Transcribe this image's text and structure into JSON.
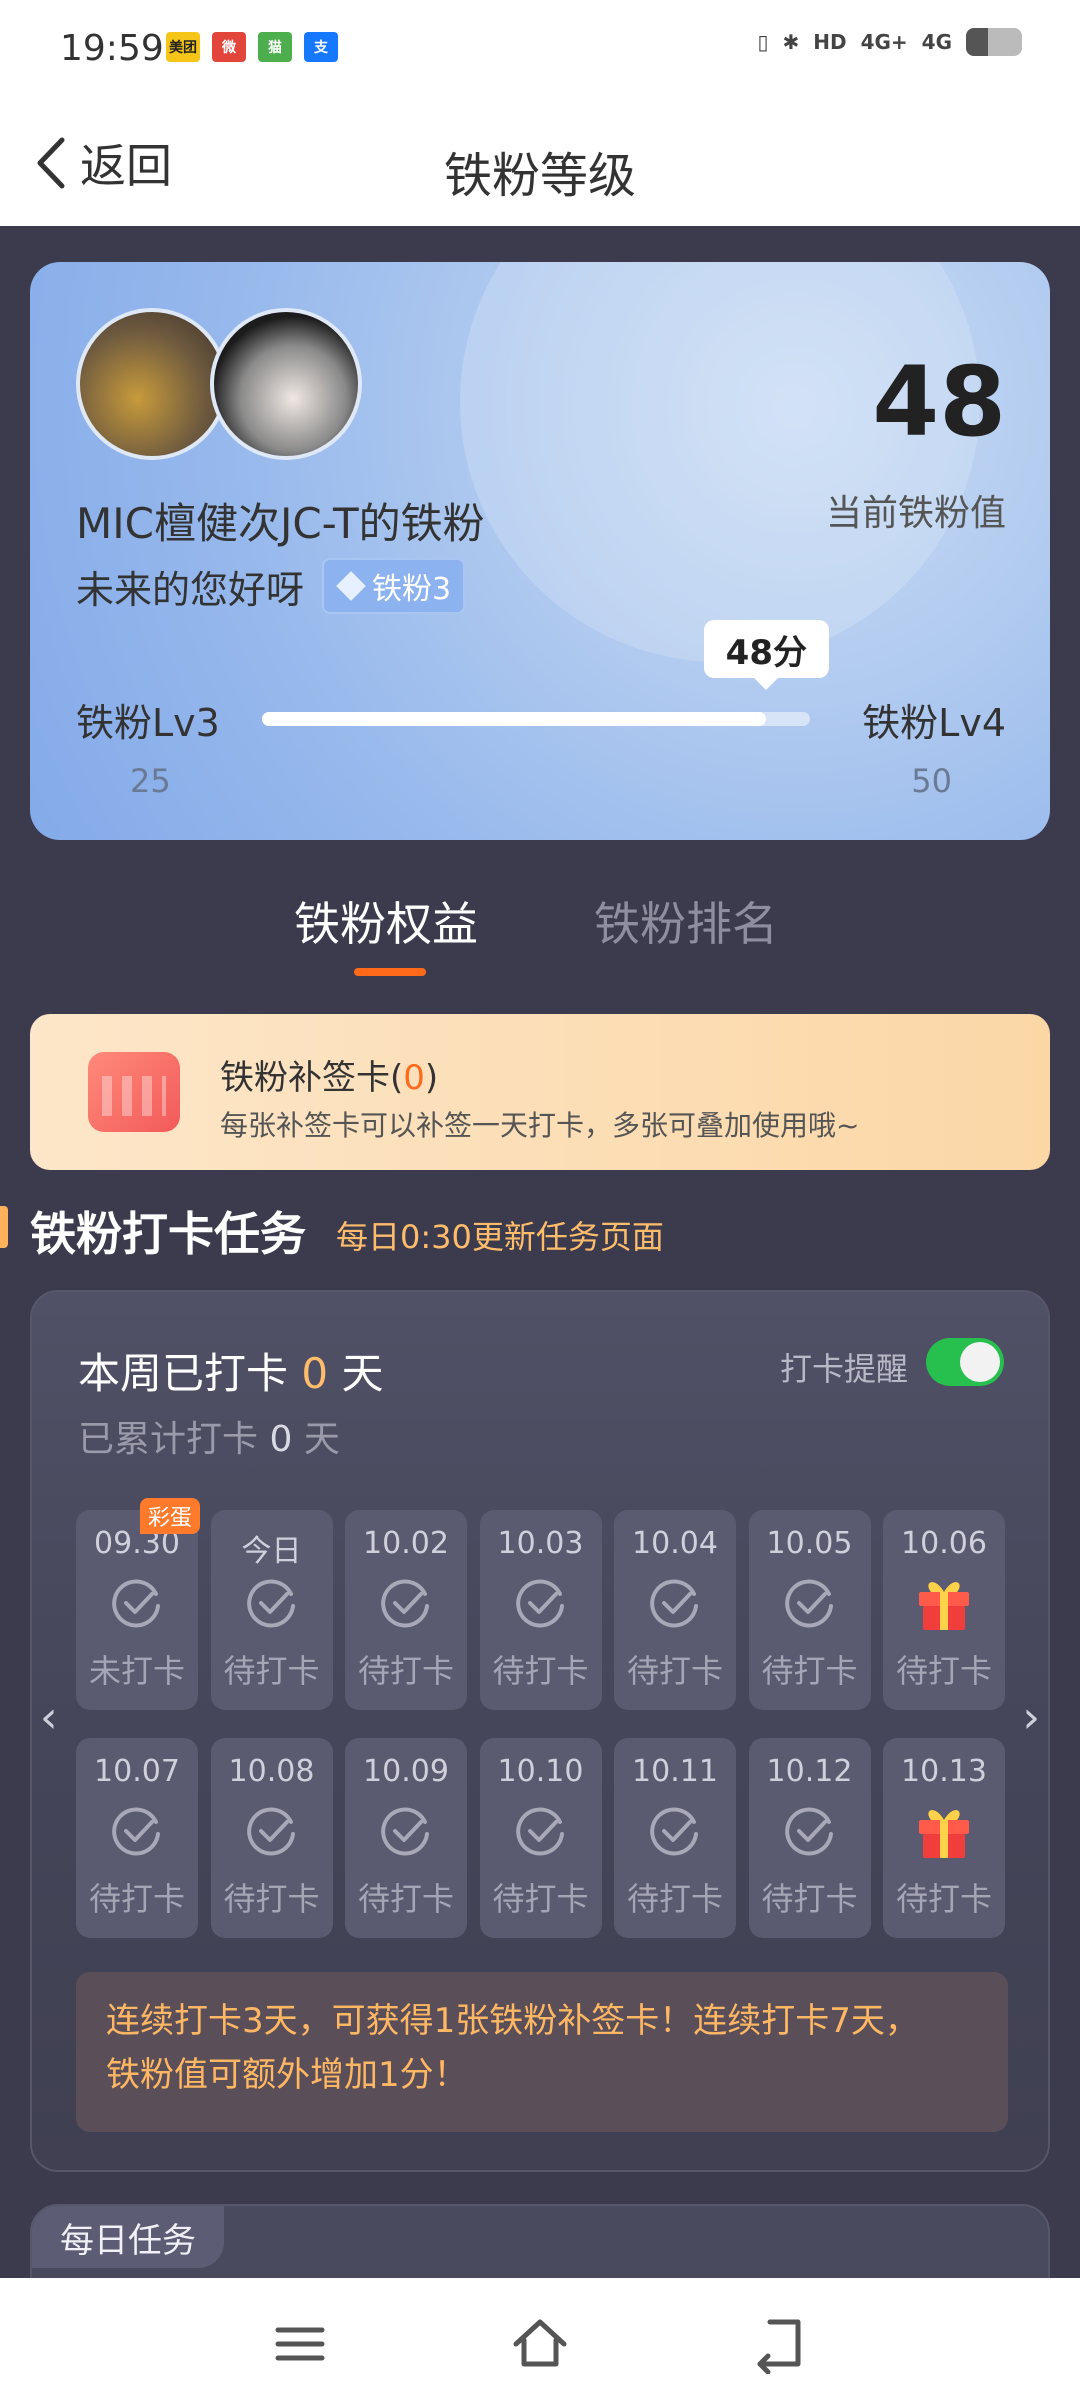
{
  "status_bar": {
    "time": "19:59",
    "apps": [
      {
        "label": "美团",
        "color": "#f5c518"
      },
      {
        "label": "微",
        "color": "#e2463b"
      },
      {
        "label": "猫",
        "color": "#4cae4c"
      },
      {
        "label": "支",
        "color": "#1677ff"
      }
    ],
    "network": "4G+",
    "network2": "4G",
    "battery_level": 0.4
  },
  "nav": {
    "back_label": "返回",
    "title": "铁粉等级"
  },
  "fan_card": {
    "fan_name": "MIC檀健次JC-T的铁粉",
    "greeting": "未来的您好呀",
    "badge": "铁粉3",
    "score": "48",
    "score_label": "当前铁粉值",
    "level_current": "铁粉Lv3",
    "level_next": "铁粉Lv4",
    "level_current_min": "25",
    "level_next_min": "50",
    "progress_tip": "48分",
    "progress": 0.92
  },
  "tabs": {
    "benefits": "铁粉权益",
    "ranking": "铁粉排名"
  },
  "makeup_card": {
    "title_prefix": "铁粉补签卡(",
    "count": "0",
    "title_suffix": ")",
    "desc": "每张补签卡可以补签一天打卡，多张可叠加使用哦~"
  },
  "checkin_section": {
    "title": "铁粉打卡任务",
    "subtitle": "每日0:30更新任务页面"
  },
  "checkin": {
    "week_prefix": "本周已打卡",
    "week_count": "0",
    "week_suffix": "天",
    "total_prefix": "已累计打卡",
    "total_count": "0",
    "total_suffix": "天",
    "remind_label": "打卡提醒",
    "remind_on": true,
    "days": [
      {
        "date": "09.30",
        "status": "未打卡",
        "egg": "彩蛋"
      },
      {
        "date": "今日",
        "status": "待打卡"
      },
      {
        "date": "10.02",
        "status": "待打卡"
      },
      {
        "date": "10.03",
        "status": "待打卡"
      },
      {
        "date": "10.04",
        "status": "待打卡"
      },
      {
        "date": "10.05",
        "status": "待打卡"
      },
      {
        "date": "10.06",
        "status": "待打卡",
        "gift": true
      },
      {
        "date": "10.07",
        "status": "待打卡"
      },
      {
        "date": "10.08",
        "status": "待打卡"
      },
      {
        "date": "10.09",
        "status": "待打卡"
      },
      {
        "date": "10.10",
        "status": "待打卡"
      },
      {
        "date": "10.11",
        "status": "待打卡"
      },
      {
        "date": "10.12",
        "status": "待打卡"
      },
      {
        "date": "10.13",
        "status": "待打卡",
        "gift": true
      }
    ],
    "note_line1": "连续打卡3天，可获得1张铁粉补签卡！连续打卡7天，",
    "note_line2": "铁粉值可额外增加1分！"
  },
  "daily_tasks": {
    "tag": "每日任务"
  },
  "bottom_nav": {
    "icons": [
      "menu-icon",
      "home-icon",
      "back-icon"
    ]
  }
}
